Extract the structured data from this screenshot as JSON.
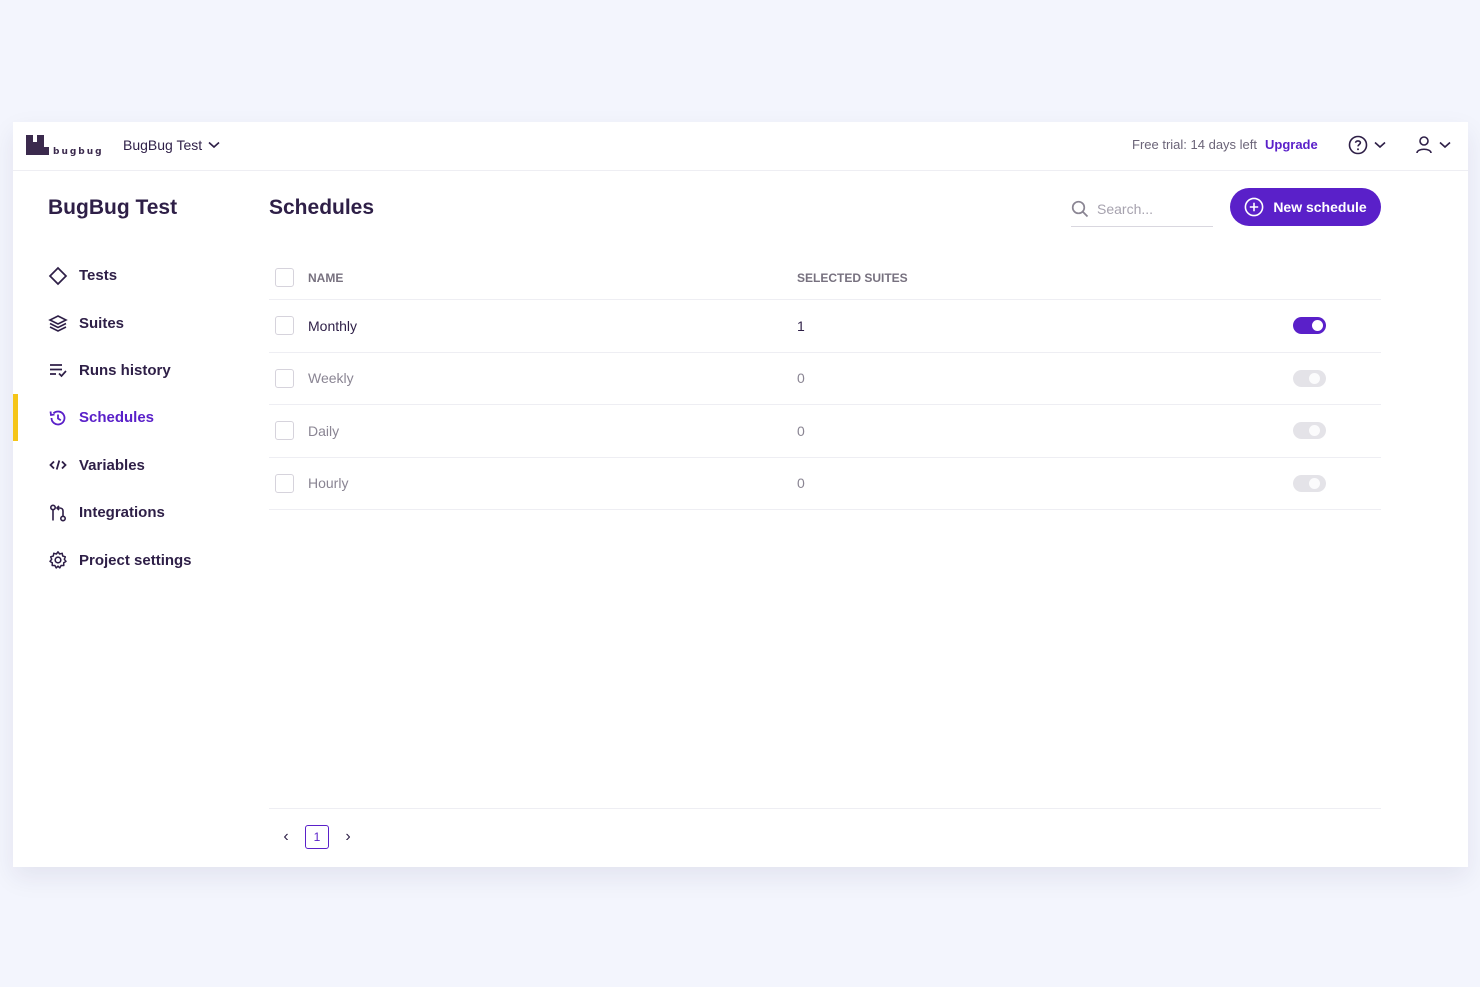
{
  "brand": {
    "logo_text": "bugbug"
  },
  "header": {
    "project_name": "BugBug Test",
    "trial_text": "Free trial: 14 days left",
    "upgrade_label": "Upgrade"
  },
  "sidebar": {
    "title": "BugBug Test",
    "items": [
      {
        "label": "Tests",
        "icon": "diamond-icon"
      },
      {
        "label": "Suites",
        "icon": "layers-icon"
      },
      {
        "label": "Runs history",
        "icon": "list-check-icon"
      },
      {
        "label": "Schedules",
        "icon": "clock-history-icon",
        "active": true
      },
      {
        "label": "Variables",
        "icon": "code-icon"
      },
      {
        "label": "Integrations",
        "icon": "git-pull-icon"
      },
      {
        "label": "Project settings",
        "icon": "gear-icon"
      }
    ]
  },
  "main": {
    "title": "Schedules",
    "search_placeholder": "Search...",
    "new_button_label": "New schedule",
    "columns": {
      "name": "NAME",
      "suites": "SELECTED SUITES"
    },
    "rows": [
      {
        "name": "Monthly",
        "suites": "1",
        "enabled": true
      },
      {
        "name": "Weekly",
        "suites": "0",
        "enabled": false
      },
      {
        "name": "Daily",
        "suites": "0",
        "enabled": false
      },
      {
        "name": "Hourly",
        "suites": "0",
        "enabled": false
      }
    ],
    "pagination": {
      "current_page": "1"
    }
  },
  "colors": {
    "accent": "#5a20c9",
    "active_indicator": "#f5c518",
    "text": "#2e1f47",
    "background": "#f3f5fd"
  }
}
